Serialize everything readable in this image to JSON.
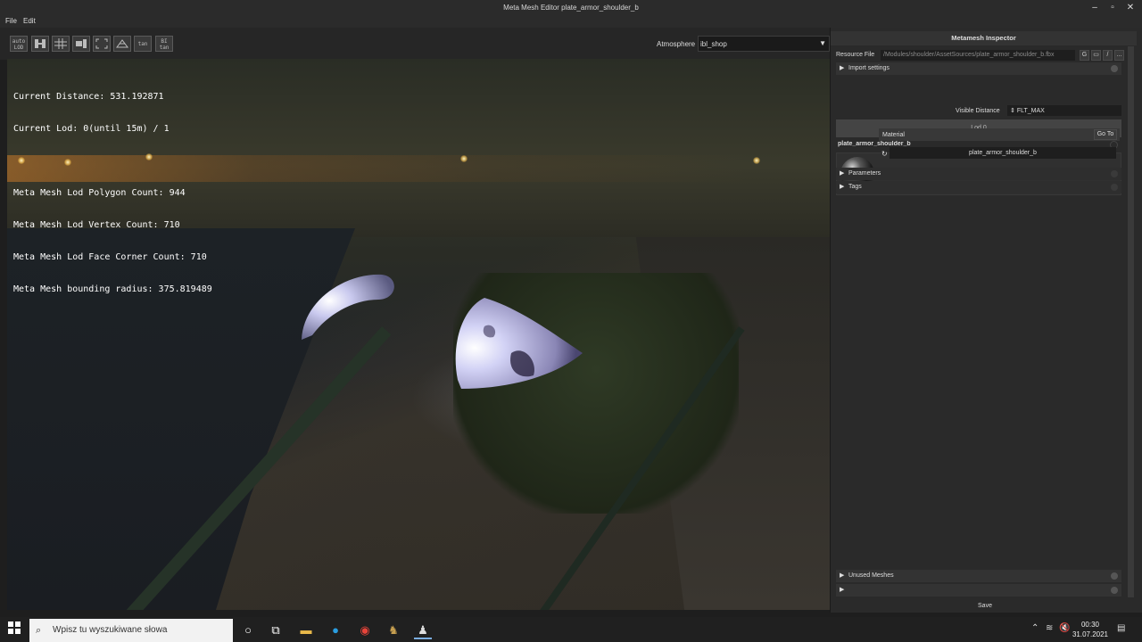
{
  "window": {
    "title": "Meta Mesh Editor plate_armor_shoulder_b"
  },
  "menu": {
    "file": "File",
    "edit": "Edit"
  },
  "toolbar": {
    "buttons": [
      "auto\nLOD",
      "",
      "",
      "",
      "",
      "",
      "norm",
      "tan",
      "BI\ntan"
    ],
    "atmosphere_label": "Atmosphere",
    "atmosphere_value": "ibl_shop"
  },
  "overlay": {
    "line1": "Current Distance: 531.192871",
    "line2": "Current Lod: 0(until 15m) / 1",
    "line3": "Meta Mesh Lod Polygon Count: 944",
    "line4": "Meta Mesh Lod Vertex Count: 710",
    "line5": "Meta Mesh Lod Face Corner Count: 710",
    "line6": "Meta Mesh bounding radius: 375.819489"
  },
  "inspector": {
    "title": "Metamesh Inspector",
    "resource_label": "Resource File",
    "resource_value": "/Modules/shoulder/AssetSources/plate_armor_shoulder_b.fbx",
    "resource_buttons": [
      "G",
      "▭",
      "/",
      "..."
    ],
    "import_settings": "Import settings",
    "visible_distance_label": "Visible Distance",
    "visible_distance_value": "FLT_MAX",
    "lod_label": "Lod 0",
    "mesh_name": "plate_armor_shoulder_b",
    "material_label": "Material",
    "goto_label": "Go To",
    "material_name": "plate_armor_shoulder_b",
    "parameters": "Parameters",
    "tags": "Tags",
    "unused_meshes": "Unused Meshes",
    "save": "Save"
  },
  "taskbar": {
    "search_placeholder": "Wpisz tu wyszukiwane słowa",
    "time": "00:30",
    "date": "31.07.2021"
  }
}
